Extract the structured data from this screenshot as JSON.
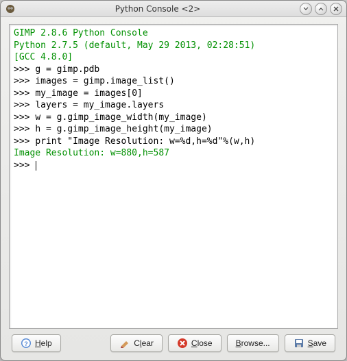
{
  "window": {
    "title": "Python Console <2>"
  },
  "console": {
    "header1": "GIMP 2.8.6 Python Console",
    "header2": "Python 2.7.5 (default, May 29 2013, 02:28:51)",
    "header3": "[GCC 4.8.0]",
    "prompt": ">>>",
    "lines": [
      "g = gimp.pdb",
      "images = gimp.image_list()",
      "my_image = images[0]",
      "layers = my_image.layers",
      "w = g.gimp_image_width(my_image)",
      "h = g.gimp_image_height(my_image)",
      "print \"Image Resolution: w=%d,h=%d\"%(w,h)"
    ],
    "output": "Image Resolution: w=880,h=587"
  },
  "buttons": {
    "help": "Help",
    "clear": "Clear",
    "close": "Close",
    "browse": "Browse...",
    "save": "Save"
  },
  "icons": {
    "app": "gimp-icon",
    "minimize": "minimize-icon",
    "maximize": "maximize-icon",
    "closewin": "close-icon",
    "help": "help-icon",
    "clear": "clear-icon",
    "close": "close-round-icon",
    "save": "save-icon"
  }
}
